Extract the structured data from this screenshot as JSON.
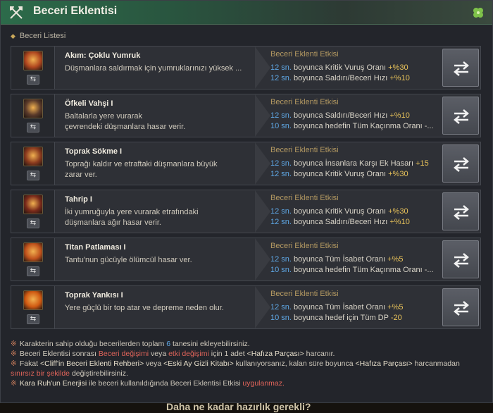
{
  "window": {
    "title": "Beceri Eklentisi",
    "title_icon": "crossed-axes-icon",
    "corner_icon": "clover-icon"
  },
  "section": {
    "label": "Beceri Listesi"
  },
  "rows": [
    {
      "name": "Akım: Çoklu Yumruk",
      "desc": "Düşmanlara saldırmak için yumruklarınızı yüksek ...",
      "effect_title": "Beceri Eklenti Etkisi",
      "icon": "fist-flurry-icon",
      "icon_color": "#b0471f",
      "effects": [
        {
          "sec": "12 sn.",
          "text": " boyunca Kritik Vuruş Oranı ",
          "val": "+%30"
        },
        {
          "sec": "12 sn.",
          "text": " boyunca Saldırı/Beceri Hızı ",
          "val": "+%10"
        }
      ]
    },
    {
      "name": "Öfkeli Vahşi I",
      "desc": "Baltalarla yere vurarak\nçevrendeki düşmanlara hasar verir.",
      "effect_title": "Beceri Eklenti Etkisi",
      "icon": "berserker-icon",
      "icon_color": "#5a3a2a",
      "effects": [
        {
          "sec": "12 sn.",
          "text": " boyunca Saldırı/Beceri Hızı ",
          "val": "+%10"
        },
        {
          "sec": "10 sn.",
          "text": " boyunca hedefin Tüm Kaçınma Oranı -...",
          "val": ""
        }
      ]
    },
    {
      "name": "Toprak Sökme I",
      "desc": "Toprağı kaldır ve etraftaki düşmanlara büyük\nzarar ver.",
      "effect_title": "Beceri Eklenti Etkisi",
      "icon": "earth-rip-icon",
      "icon_color": "#8a3a1e",
      "effects": [
        {
          "sec": "12 sn.",
          "text": " boyunca İnsanlara Karşı Ek Hasarı ",
          "val": "+15"
        },
        {
          "sec": "12 sn.",
          "text": " boyunca Kritik Vuruş Oranı ",
          "val": "+%30"
        }
      ]
    },
    {
      "name": "Tahrip I",
      "desc": "İki yumruğuyla yere vurarak etrafındaki\ndüşmanlara ağır hasar verir.",
      "effect_title": "Beceri Eklenti Etkisi",
      "icon": "double-fist-icon",
      "icon_color": "#7a2a1a",
      "effects": [
        {
          "sec": "12 sn.",
          "text": " boyunca Kritik Vuruş Oranı ",
          "val": "+%30"
        },
        {
          "sec": "12 sn.",
          "text": " boyunca Saldırı/Beceri Hızı ",
          "val": "+%10"
        }
      ]
    },
    {
      "name": "Titan Patlaması I",
      "desc": "Tantu'nun gücüyle ölümcül hasar ver.",
      "effect_title": "Beceri Eklenti Etkisi",
      "icon": "titan-burst-icon",
      "icon_color": "#c0521c",
      "effects": [
        {
          "sec": "12 sn.",
          "text": " boyunca Tüm İsabet Oranı ",
          "val": "+%5"
        },
        {
          "sec": "10 sn.",
          "text": " boyunca hedefin Tüm Kaçınma Oranı -...",
          "val": ""
        }
      ]
    },
    {
      "name": "Toprak Yankısı I",
      "desc": "Yere güçlü bir top atar ve depreme neden olur.",
      "effect_title": "Beceri Eklenti Etkisi",
      "icon": "earth-echo-icon",
      "icon_color": "#d05a12",
      "effects": [
        {
          "sec": "12 sn.",
          "text": " boyunca Tüm İsabet Oranı ",
          "val": "+%5"
        },
        {
          "sec": "10 sn.",
          "text": " boyunca hedef için Tüm DP ",
          "val": "-20"
        }
      ]
    }
  ],
  "notes": [
    [
      {
        "t": "Karakterin sahip olduğu becerilerden toplam ",
        "c": ""
      },
      {
        "t": "6",
        "c": "num"
      },
      {
        "t": " tanesini ekleyebilirsiniz.",
        "c": ""
      }
    ],
    [
      {
        "t": "Beceri Eklentisi sonrası ",
        "c": ""
      },
      {
        "t": "Beceri değişimi",
        "c": "red"
      },
      {
        "t": " veya ",
        "c": ""
      },
      {
        "t": "etki değişimi",
        "c": "red"
      },
      {
        "t": " için 1 adet ",
        "c": ""
      },
      {
        "t": "<Hafıza Parçası>",
        "c": "hl"
      },
      {
        "t": " harcanır.",
        "c": ""
      }
    ],
    [
      {
        "t": "Fakat ",
        "c": ""
      },
      {
        "t": "<Cliff'in Beceri Eklenti Rehberi>",
        "c": "hl"
      },
      {
        "t": " veya ",
        "c": ""
      },
      {
        "t": "<Eski Ay Gizli Kitabı>",
        "c": "hl"
      },
      {
        "t": " kullanıyorsanız, kalan süre boyunca ",
        "c": ""
      },
      {
        "t": "<Hafıza Parçası>",
        "c": "hl"
      },
      {
        "t": " harcanmadan",
        "c": ""
      }
    ],
    [
      {
        "t": "sınırsız bir şekilde",
        "c": "red"
      },
      {
        "t": " değiştirebilirsiniz.",
        "c": ""
      }
    ],
    [
      {
        "t": "Kara Ruh'un Enerjisi",
        "c": "hl"
      },
      {
        "t": " ile beceri kullanıldığında Beceri Eklentisi Etkisi ",
        "c": ""
      },
      {
        "t": "uygulanmaz.",
        "c": "red"
      }
    ]
  ],
  "background_text": "Daha ne kadar hazırlık gerekli?"
}
